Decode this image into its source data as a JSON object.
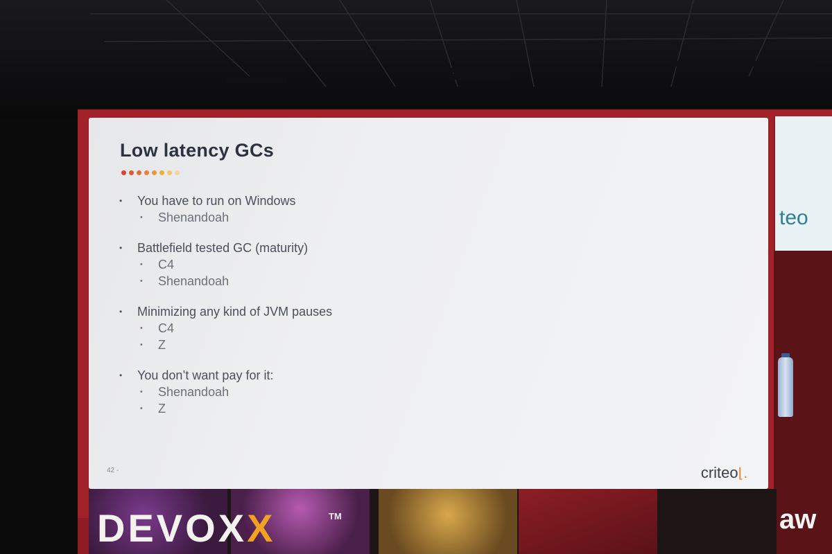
{
  "slide": {
    "title": "Low latency GCs",
    "dot_colors": [
      "#d6452f",
      "#dc5a31",
      "#e06e34",
      "#e48337",
      "#e8983a",
      "#ecad3d",
      "#f0c56a",
      "#f2d89a"
    ],
    "groups": [
      {
        "text": "You have to run on Windows",
        "subs": [
          "Shenandoah"
        ]
      },
      {
        "text": "Battlefield tested GC (maturity)",
        "subs": [
          "C4",
          "Shenandoah"
        ]
      },
      {
        "text": "Minimizing any kind of JVM pauses",
        "subs": [
          "C4",
          "Z"
        ]
      },
      {
        "text": "You don’t want pay for it:",
        "subs": [
          "Shenandoah",
          "Z"
        ]
      }
    ],
    "page_number": "42 -",
    "logo": "criteo"
  },
  "side_screen": {
    "logo_text": "teo"
  },
  "banner": {
    "brand": "DEVOX",
    "brand_x": "X",
    "tm": "TM",
    "sponsor": "aw"
  }
}
